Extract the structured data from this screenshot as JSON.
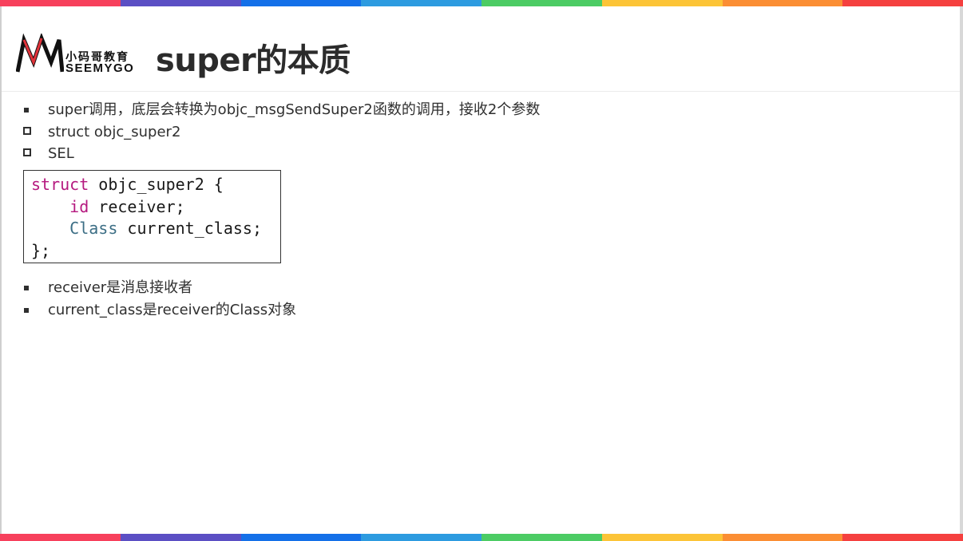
{
  "stripe_colors": [
    "#f7405c",
    "#5b4fc4",
    "#1470e8",
    "#2d9be0",
    "#4ccc64",
    "#fcc437",
    "#fb8e34",
    "#f5403f"
  ],
  "logo": {
    "cn": "小码哥教育",
    "en": "SEEMYGO"
  },
  "title": "super的本质",
  "bullets_top": [
    {
      "style": "filled",
      "text": "super调用，底层会转换为objc_msgSendSuper2函数的调用，接收2个参数"
    },
    {
      "style": "hollow",
      "text": "struct objc_super2"
    },
    {
      "style": "hollow",
      "text": "SEL"
    }
  ],
  "code": {
    "line1": {
      "kw": "struct",
      "rest": " objc_super2 {"
    },
    "line2": {
      "indent": "    ",
      "kw": "id",
      "rest": " receiver;"
    },
    "line3": {
      "indent": "    ",
      "ty": "Class",
      "rest": " current_class;"
    },
    "line4": "};"
  },
  "bullets_bottom": [
    {
      "style": "filled",
      "text": "receiver是消息接收者"
    },
    {
      "style": "filled",
      "text": "current_class是receiver的Class对象"
    }
  ]
}
